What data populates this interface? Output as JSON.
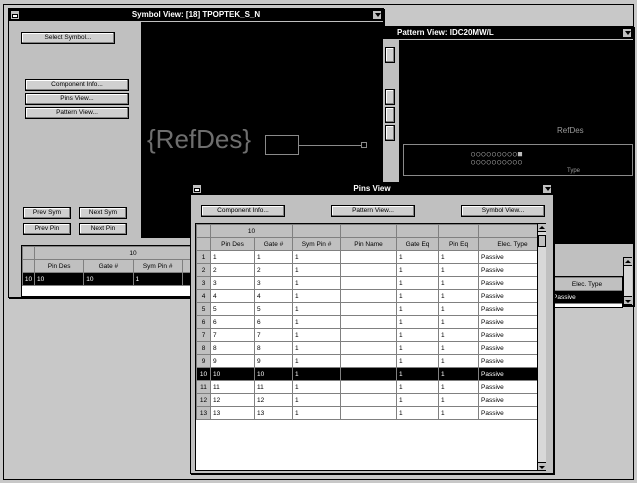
{
  "symbol_view": {
    "title": "Symbol View: [18] TPOPTEK_S_N",
    "buttons": {
      "select_symbol": "Select Symbol...",
      "component_info": "Component Info...",
      "pins_view": "Pins View...",
      "pattern_view": "Pattern View...",
      "prev_sym": "Prev Sym",
      "next_sym": "Next Sym",
      "prev_pin": "Prev Pin",
      "next_pin": "Next Pin"
    },
    "refdes_label": "{RefDes}",
    "grid": {
      "group_header": "10",
      "columns": [
        "Pin Des",
        "Gate #",
        "Sym Pin #",
        "Pi"
      ],
      "rows": [
        [
          "10",
          "10",
          "10",
          "1",
          ""
        ]
      ]
    }
  },
  "pattern_view": {
    "title": "Pattern View: IDC20MW/L",
    "refdes_label": "RefDes",
    "type_label": "Type",
    "grid": {
      "columns": [
        "Elec. Type"
      ],
      "rows": [
        [
          "Passive"
        ]
      ]
    }
  },
  "pins_view": {
    "title": "Pins View",
    "buttons": {
      "component_info": "Component Info...",
      "pattern_view": "Pattern View...",
      "symbol_view": "Symbol View..."
    },
    "group_header": "10",
    "columns": [
      "Pin Des",
      "Gate #",
      "Sym Pin #",
      "Pin Name",
      "Gate Eq",
      "Pin Eq",
      "Elec. Type"
    ],
    "rows": [
      [
        "1",
        "1",
        "1",
        "1",
        "",
        "1",
        "1",
        "Passive"
      ],
      [
        "2",
        "2",
        "2",
        "1",
        "",
        "1",
        "1",
        "Passive"
      ],
      [
        "3",
        "3",
        "3",
        "1",
        "",
        "1",
        "1",
        "Passive"
      ],
      [
        "4",
        "4",
        "4",
        "1",
        "",
        "1",
        "1",
        "Passive"
      ],
      [
        "5",
        "5",
        "5",
        "1",
        "",
        "1",
        "1",
        "Passive"
      ],
      [
        "6",
        "6",
        "6",
        "1",
        "",
        "1",
        "1",
        "Passive"
      ],
      [
        "7",
        "7",
        "7",
        "1",
        "",
        "1",
        "1",
        "Passive"
      ],
      [
        "8",
        "8",
        "8",
        "1",
        "",
        "1",
        "1",
        "Passive"
      ],
      [
        "9",
        "9",
        "9",
        "1",
        "",
        "1",
        "1",
        "Passive"
      ],
      [
        "10",
        "10",
        "10",
        "1",
        "",
        "1",
        "1",
        "Passive"
      ],
      [
        "11",
        "11",
        "11",
        "1",
        "",
        "1",
        "1",
        "Passive"
      ],
      [
        "12",
        "12",
        "12",
        "1",
        "",
        "1",
        "1",
        "Passive"
      ],
      [
        "13",
        "13",
        "13",
        "1",
        "",
        "1",
        "1",
        "Passive"
      ]
    ],
    "selected_row": "10"
  }
}
